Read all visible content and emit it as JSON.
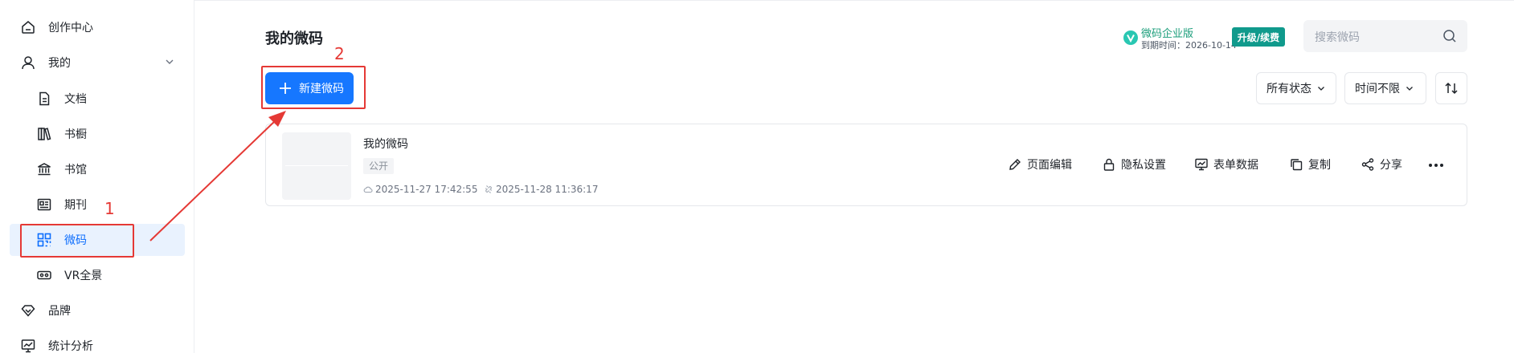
{
  "sidebar": {
    "items": [
      {
        "label": "创作中心",
        "icon": "home-icon"
      },
      {
        "label": "我的",
        "icon": "user-icon"
      },
      {
        "label": "文档",
        "icon": "document-icon"
      },
      {
        "label": "书橱",
        "icon": "bookshelf-icon"
      },
      {
        "label": "书馆",
        "icon": "library-icon"
      },
      {
        "label": "期刊",
        "icon": "journal-icon"
      },
      {
        "label": "微码",
        "icon": "qrcode-icon",
        "active": true
      },
      {
        "label": "VR全景",
        "icon": "vr-icon"
      },
      {
        "label": "品牌",
        "icon": "brand-diamond-icon"
      },
      {
        "label": "统计分析",
        "icon": "chart-analysis-icon"
      }
    ]
  },
  "header": {
    "title": "我的微码",
    "enterprise": {
      "name": "微码企业版",
      "expiry": "到期时间：2026-10-14"
    },
    "upgrade_label": "升级/续费",
    "search_placeholder": "搜索微码"
  },
  "toolbar": {
    "new_button_label": "新建微码",
    "status_filter": "所有状态",
    "time_filter": "时间不限"
  },
  "list": {
    "items": [
      {
        "title": "我的微码",
        "tag": "公开",
        "created": "2025-11-27 17:42:55",
        "updated": "2025-11-28 11:36:17",
        "actions": [
          "页面编辑",
          "隐私设置",
          "表单数据",
          "复制",
          "分享"
        ]
      }
    ]
  },
  "annotations": {
    "step1": "1",
    "step2": "2"
  },
  "colors": {
    "primary": "#1677ff",
    "active_bg": "#e9f2fe",
    "annotation": "#e53935",
    "upgrade": "#109a8c"
  }
}
